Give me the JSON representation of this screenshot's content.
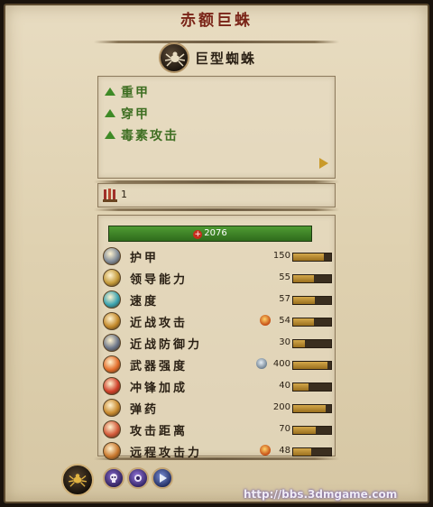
{
  "unit_name": "赤额巨蛛",
  "unit_type": "巨型蜘蛛",
  "attributes": [
    "重甲",
    "穿甲",
    "毒素攻击"
  ],
  "ammo_count": "1",
  "health": "2076",
  "stats": [
    {
      "label": "护甲",
      "value": "150",
      "level": 0.8,
      "icon": "armor-icon",
      "color": "#7f8a97"
    },
    {
      "label": "领导能力",
      "value": "55",
      "level": 0.55,
      "icon": "leadership-icon",
      "color": "#c49a3a"
    },
    {
      "label": "速度",
      "value": "57",
      "level": 0.57,
      "icon": "speed-icon",
      "color": "#3aa3b0"
    },
    {
      "label": "近战攻击",
      "value": "54",
      "level": 0.54,
      "icon": "melee-attack-icon",
      "color": "#c48a2c",
      "modifier": "fire-damage-icon"
    },
    {
      "label": "近战防御力",
      "value": "30",
      "level": 0.3,
      "icon": "melee-defense-icon",
      "color": "#6c7689"
    },
    {
      "label": "武器强度",
      "value": "400",
      "level": 0.9,
      "icon": "weapon-strength-icon",
      "color": "#e36e2c",
      "modifier": "armour-piercing-icon"
    },
    {
      "label": "冲锋加成",
      "value": "40",
      "level": 0.4,
      "icon": "charge-bonus-icon",
      "color": "#d0402a"
    },
    {
      "label": "弹药",
      "value": "200",
      "level": 0.85,
      "icon": "ammunition-icon",
      "color": "#c98a2e"
    },
    {
      "label": "攻击距离",
      "value": "70",
      "level": 0.6,
      "icon": "range-icon",
      "color": "#d35a3a"
    },
    {
      "label": "远程攻击力",
      "value": "48",
      "level": 0.48,
      "icon": "missile-damage-icon",
      "color": "#c9782e",
      "modifier": "fire-damage-icon"
    }
  ],
  "watermark": "http://bbs.3dmgame.com"
}
